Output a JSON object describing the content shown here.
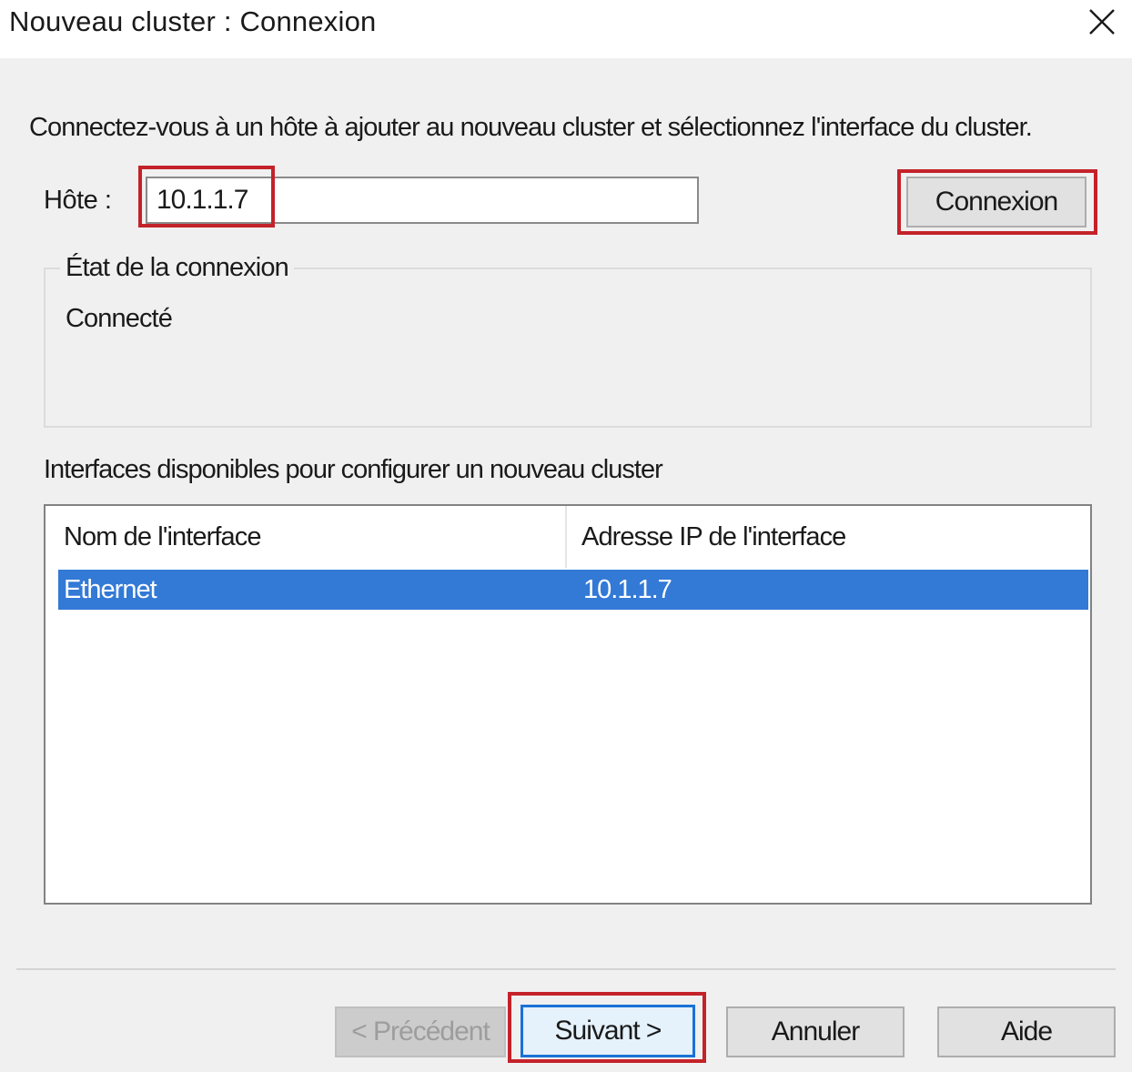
{
  "window": {
    "title": "Nouveau cluster : Connexion"
  },
  "intro_text": "Connectez-vous à un hôte à ajouter au nouveau cluster et sélectionnez l'interface du cluster.",
  "host": {
    "label": "Hôte :",
    "value": "10.1.1.7",
    "connect_label": "Connexion"
  },
  "connection_status": {
    "group_label": "État de la connexion",
    "value": "Connecté"
  },
  "interfaces": {
    "label": "Interfaces disponibles pour configurer un nouveau cluster",
    "columns": [
      "Nom de l'interface",
      "Adresse IP de l'interface"
    ],
    "rows": [
      {
        "name": "Ethernet",
        "ip": "10.1.1.7",
        "selected": true
      }
    ]
  },
  "footer": {
    "prev_label": "< Précédent",
    "next_label": "Suivant >",
    "cancel_label": "Annuler",
    "help_label": "Aide"
  },
  "colors": {
    "highlight_box": "#c4222a",
    "selection": "#3379d6",
    "default_button_border": "#1a72d6"
  },
  "icons": {
    "close": "close-icon"
  }
}
